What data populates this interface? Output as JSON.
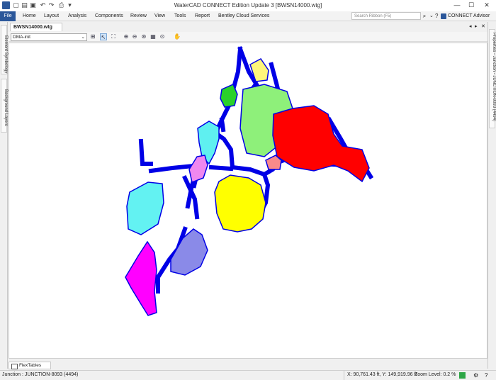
{
  "window": {
    "title": "WaterCAD CONNECT Edition Update 3 [BWSN14000.wtg]",
    "minimize": "—",
    "maximize": "☐",
    "close": "✕"
  },
  "ribbon": {
    "file_label": "File",
    "tabs": [
      "Home",
      "Layout",
      "Analysis",
      "Components",
      "Review",
      "View",
      "Tools",
      "Report",
      "Bentley Cloud Services"
    ],
    "search_placeholder": "Search Ribbon (F5)",
    "advisor_label": "CONNECT Advisor",
    "file_color": "#2b579a"
  },
  "left_panel": {
    "tabs": [
      "Element Symbology",
      "Background Layers"
    ]
  },
  "right_panel": {
    "tab": "Properties - Junction - JUNCTION-8093 (4494)"
  },
  "drawing": {
    "tab_label": "BWSN14000.wtg",
    "selection_set": "DMA-init"
  },
  "bottom": {
    "flextables_label": "FlexTables"
  },
  "status": {
    "selection": "Junction : JUNCTION-8093 (4494)",
    "coordinates": "X: 90,761.43 ft, Y: 149,919.96 ft",
    "zoom": "Zoom Level: 0.2 %"
  },
  "map_colors": {
    "network": "#0000e6",
    "yellow": "#ffff00",
    "light_yellow": "#fff67a",
    "green": "#2ad12a",
    "light_green": "#8ef07a",
    "red": "#ff0000",
    "pink": "#f88a8a",
    "cyan": "#5ff0f0",
    "light_cyan": "#63f2f2",
    "violet": "#ef88ef",
    "lavender": "#8a8ae8",
    "magenta": "#ff00ff"
  }
}
